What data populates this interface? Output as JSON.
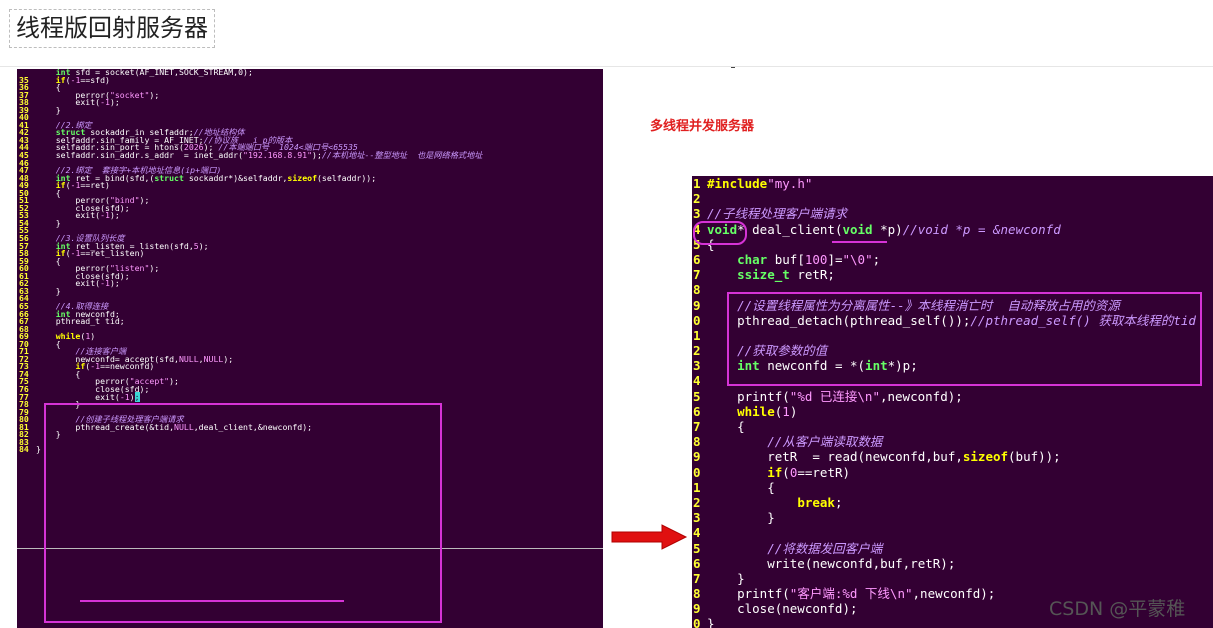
{
  "page": {
    "title": "线程版回射服务器"
  },
  "annotation": {
    "label": "多线程并发服务器"
  },
  "watermark": "CSDN @平蒙稚",
  "left_code": [
    {
      "n": "",
      "html": "    <span class=\"kt\">int</span> sfd = socket(AF_INET,SOCK_STREAM,0);"
    },
    {
      "n": "35",
      "html": "    <span class=\"kw\">if</span>(<span class=\"nm\">-1</span>==sfd)"
    },
    {
      "n": "36",
      "html": "    {"
    },
    {
      "n": "37",
      "html": "        perror(<span class=\"st\">\"socket\"</span>);"
    },
    {
      "n": "38",
      "html": "        exit(<span class=\"nm\">-1</span>);"
    },
    {
      "n": "39",
      "html": "    }"
    },
    {
      "n": "40",
      "html": ""
    },
    {
      "n": "41",
      "html": "    <span class=\"cm\">//2.绑定</span>"
    },
    {
      "n": "42",
      "html": "    <span class=\"kt\">struct</span> sockaddr_in selfaddr;<span class=\"cm\">//地址结构体</span>"
    },
    {
      "n": "43",
      "html": "    selfaddr.sin_family = AF_INET;<span class=\"cm\">//协议族   i p的版本</span>"
    },
    {
      "n": "44",
      "html": "    selfaddr.sin_port = htons(<span class=\"nm\">2026</span>); <span class=\"cm\">//本端端口号  1024&lt;端口号&lt;65535</span>"
    },
    {
      "n": "45",
      "html": "    selfaddr.sin_addr.s_addr  = inet_addr(<span class=\"st\">\"192.168.8.91\"</span>);<span class=\"cm\">//本机地址--整型地址  也是网络格式地址</span>"
    },
    {
      "n": "46",
      "html": ""
    },
    {
      "n": "47",
      "html": "    <span class=\"cm\">//2.绑定  套接字+本机地址信息(ip+端口)</span>"
    },
    {
      "n": "48",
      "html": "    <span class=\"kt\">int</span> ret = bind(sfd,(<span class=\"kt\">struct</span> sockaddr*)&amp;selfaddr,<span class=\"kw\">sizeof</span>(selfaddr));"
    },
    {
      "n": "49",
      "html": "    <span class=\"kw\">if</span>(<span class=\"nm\">-1</span>==ret)"
    },
    {
      "n": "50",
      "html": "    {"
    },
    {
      "n": "51",
      "html": "        perror(<span class=\"st\">\"bind\"</span>);"
    },
    {
      "n": "52",
      "html": "        close(sfd);"
    },
    {
      "n": "53",
      "html": "        exit(<span class=\"nm\">-1</span>);"
    },
    {
      "n": "54",
      "html": "    }"
    },
    {
      "n": "55",
      "html": ""
    },
    {
      "n": "56",
      "html": "    <span class=\"cm\">//3.设置队列长度</span>"
    },
    {
      "n": "57",
      "html": "    <span class=\"kt\">int</span> ret_listen = listen(sfd,<span class=\"nm\">5</span>);"
    },
    {
      "n": "58",
      "html": "    <span class=\"kw\">if</span>(<span class=\"nm\">-1</span>==ret_listen)"
    },
    {
      "n": "59",
      "html": "    {"
    },
    {
      "n": "60",
      "html": "        perror(<span class=\"st\">\"listen\"</span>);"
    },
    {
      "n": "61",
      "html": "        close(sfd);"
    },
    {
      "n": "62",
      "html": "        exit(<span class=\"nm\">-1</span>);"
    },
    {
      "n": "63",
      "html": "    }"
    },
    {
      "n": "64",
      "html": ""
    },
    {
      "n": "65",
      "html": "    <span class=\"cm\">//4.取得连接</span>"
    },
    {
      "n": "66",
      "html": "    <span class=\"kt\">int</span> newconfd;"
    },
    {
      "n": "67",
      "html": "    pthread_t tid;"
    },
    {
      "n": "68",
      "html": ""
    },
    {
      "n": "69",
      "html": "    <span class=\"kw\">while</span>(<span class=\"nm\">1</span>)"
    },
    {
      "n": "70",
      "html": "    {"
    },
    {
      "n": "71",
      "html": "        <span class=\"cm\">//连接客户端</span>"
    },
    {
      "n": "72",
      "html": "        newconfd= accept(sfd,<span class=\"nm\">NULL</span>,<span class=\"nm\">NULL</span>);"
    },
    {
      "n": "73",
      "html": "        <span class=\"kw\">if</span>(<span class=\"nm\">-1</span>==newconfd)"
    },
    {
      "n": "74",
      "html": "        {"
    },
    {
      "n": "75",
      "html": "            perror(<span class=\"st\">\"accept\"</span>);"
    },
    {
      "n": "76",
      "html": "            close(sfd);"
    },
    {
      "n": "77",
      "html": "            exit(<span class=\"nm\">-1</span>)<span class=\"cursor\">;</span>"
    },
    {
      "n": "78",
      "html": "        }"
    },
    {
      "n": "79",
      "html": ""
    },
    {
      "n": "80",
      "html": "        <span class=\"cm\">//创建子线程处理客户端请求</span>"
    },
    {
      "n": "81",
      "html": "        pthread_create(&amp;tid,<span class=\"nm\">NULL</span>,deal_client,&amp;newconfd);"
    },
    {
      "n": "82",
      "html": "    }"
    },
    {
      "n": "83",
      "html": ""
    },
    {
      "n": "84",
      "html": "}"
    }
  ],
  "right_code": [
    {
      "n": "1",
      "html": "<span class=\"kw\">#include</span><span class=\"st\">\"my.h\"</span>"
    },
    {
      "n": "2",
      "html": ""
    },
    {
      "n": "3",
      "html": "<span class=\"cm\">//子线程处理客户端请求</span>"
    },
    {
      "n": "4",
      "html": "<span class=\"kt\">void</span>* deal_client(<span class=\"kt\">void</span> *p)<span class=\"cm\">//void *p = &amp;newconfd</span>"
    },
    {
      "n": "5",
      "html": "{"
    },
    {
      "n": "6",
      "html": "    <span class=\"kt\">char</span> buf[<span class=\"nm\">100</span>]=<span class=\"st\">\"\\0\"</span>;"
    },
    {
      "n": "7",
      "html": "    <span class=\"kt\">ssize_t</span> retR;"
    },
    {
      "n": "8",
      "html": ""
    },
    {
      "n": "9",
      "html": "    <span class=\"cm\">//设置线程属性为分离属性--》本线程消亡时  自动释放占用的资源</span>"
    },
    {
      "n": "0",
      "html": "    pthread_detach(pthread_self());<span class=\"cm\">//pthread_self() 获取本线程的tid</span>"
    },
    {
      "n": "1",
      "html": ""
    },
    {
      "n": "2",
      "html": "    <span class=\"cm\">//获取参数的值</span>"
    },
    {
      "n": "3",
      "html": "    <span class=\"kt\">int</span> newconfd = *(<span class=\"kt\">int</span>*)p;"
    },
    {
      "n": "4",
      "html": ""
    },
    {
      "n": "5",
      "html": "    printf(<span class=\"st\">\"%d 已连接\\n\"</span>,newconfd);"
    },
    {
      "n": "6",
      "html": "    <span class=\"kw\">while</span>(<span class=\"nm\">1</span>)"
    },
    {
      "n": "7",
      "html": "    {"
    },
    {
      "n": "8",
      "html": "        <span class=\"cm\">//从客户端读取数据</span>"
    },
    {
      "n": "9",
      "html": "        retR  = read(newconfd,buf,<span class=\"kw\">sizeof</span>(buf));"
    },
    {
      "n": "0",
      "html": "        <span class=\"kw\">if</span>(<span class=\"nm\">0</span>==retR)"
    },
    {
      "n": "1",
      "html": "        {"
    },
    {
      "n": "2",
      "html": "            <span class=\"kw\">break</span>;"
    },
    {
      "n": "3",
      "html": "        }"
    },
    {
      "n": "4",
      "html": ""
    },
    {
      "n": "5",
      "html": "        <span class=\"cm\">//将数据发回客户端</span>"
    },
    {
      "n": "6",
      "html": "        write(newconfd,buf,retR);"
    },
    {
      "n": "7",
      "html": "    }"
    },
    {
      "n": "8",
      "html": "    printf(<span class=\"st\">\"客户端:%d 下线\\n\"</span>,newconfd);"
    },
    {
      "n": "9",
      "html": "    close(newconfd);"
    },
    {
      "n": "0",
      "html": "}"
    }
  ],
  "colors": {
    "terminal_bg": "#330033",
    "highlight": "#d633d6",
    "arrow": "#e01010"
  }
}
